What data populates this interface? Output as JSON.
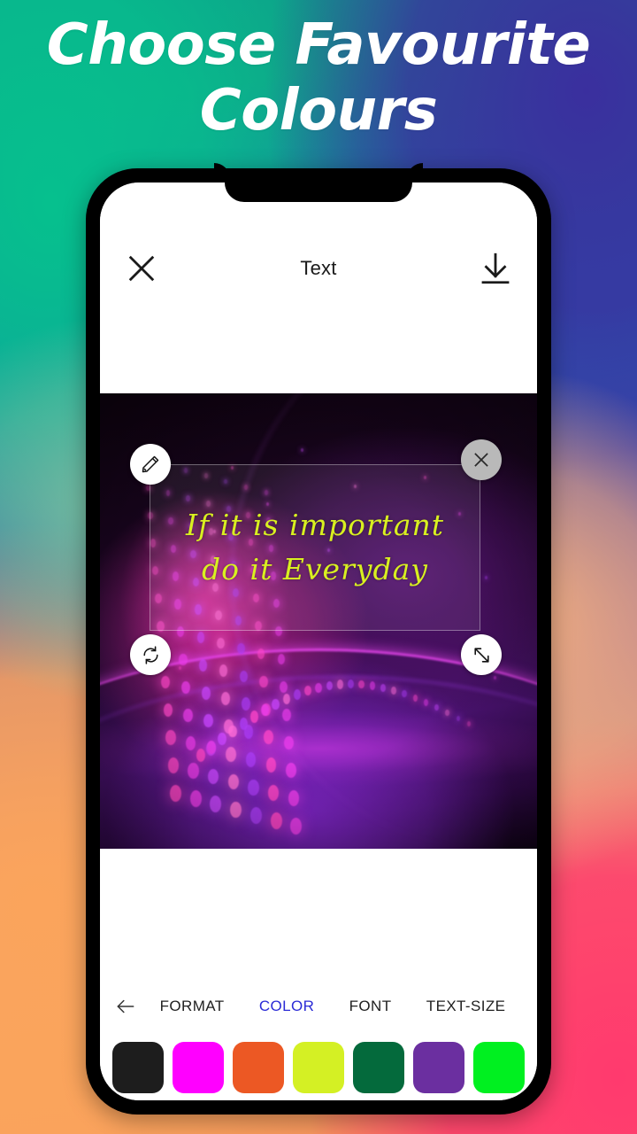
{
  "promo": {
    "heading_line1": "Choose Favourite",
    "heading_line2": "Colours",
    "heading_color": "#ffffff"
  },
  "app": {
    "header": {
      "title": "Text",
      "close_icon": "close-x-icon",
      "save_icon": "download-arrow-icon"
    },
    "canvas": {
      "overlay_text": "If  it is important\ndo it Everyday",
      "overlay_text_color": "#d9f020",
      "handles": [
        {
          "name": "edit-handle",
          "icon": "pencil-icon",
          "position": "top-left"
        },
        {
          "name": "delete-handle",
          "icon": "close-x-icon",
          "position": "top-right"
        },
        {
          "name": "rotate-handle",
          "icon": "rotate-refresh-icon",
          "position": "bottom-left"
        },
        {
          "name": "resize-handle",
          "icon": "diagonal-resize-icon",
          "position": "bottom-right"
        }
      ]
    },
    "toolbar": {
      "back_icon": "back-arrow-icon",
      "tabs": [
        {
          "label": "FORMAT",
          "active": false
        },
        {
          "label": "COLOR",
          "active": true
        },
        {
          "label": "FONT",
          "active": false
        },
        {
          "label": "TEXT-SIZE",
          "active": false
        }
      ],
      "active_tab_color": "#2b2bd6"
    },
    "colors": [
      {
        "name": "black",
        "hex": "#1d1d1d"
      },
      {
        "name": "magenta",
        "hex": "#ff00ff"
      },
      {
        "name": "orange",
        "hex": "#ec5824"
      },
      {
        "name": "yellow-green",
        "hex": "#d4f024"
      },
      {
        "name": "dark-green",
        "hex": "#046a3c"
      },
      {
        "name": "purple",
        "hex": "#6b2fa0"
      },
      {
        "name": "bright-green",
        "hex": "#00f020"
      }
    ]
  }
}
